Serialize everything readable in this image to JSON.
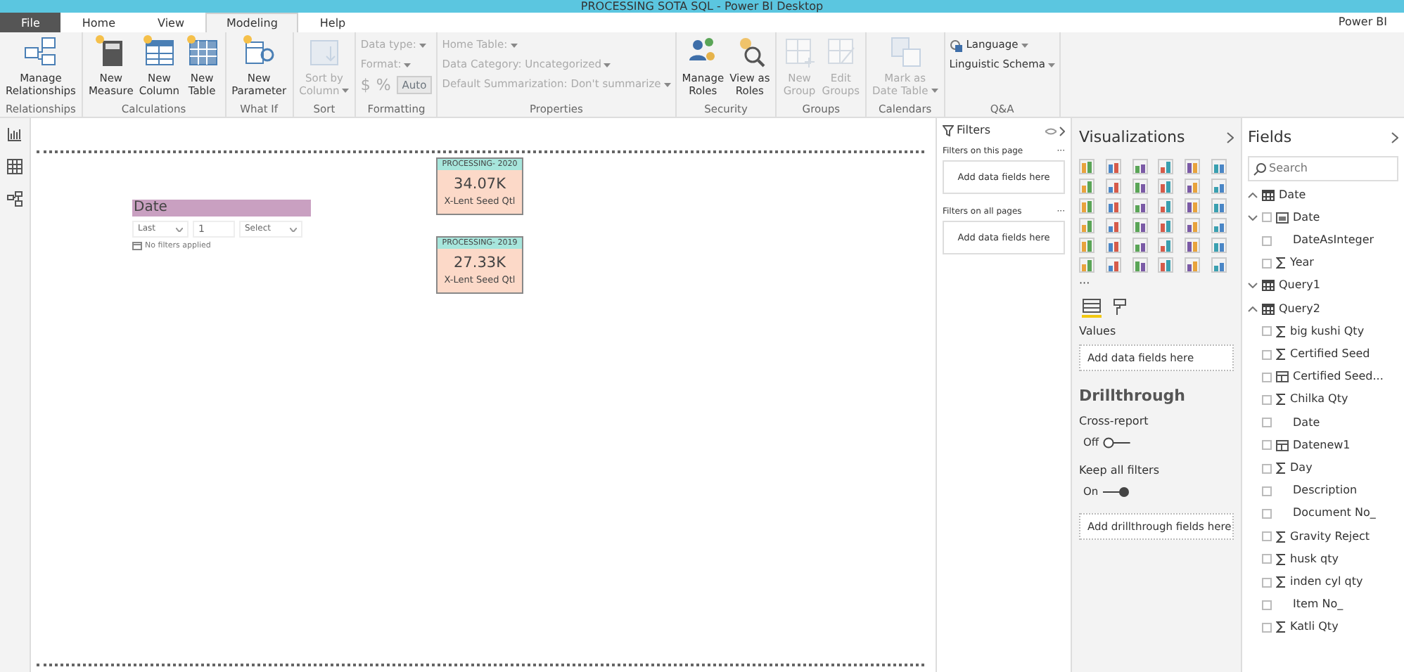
{
  "window": {
    "title": "PROCESSING SOTA SQL - Power BI Desktop"
  },
  "tabs": [
    {
      "label": "File",
      "selected": false,
      "kind": "file"
    },
    {
      "label": "Home",
      "selected": false,
      "kind": "tab"
    },
    {
      "label": "View",
      "selected": false,
      "kind": "tab"
    },
    {
      "label": "Modeling",
      "selected": true,
      "kind": "tab"
    },
    {
      "label": "Help",
      "selected": false,
      "kind": "tab"
    }
  ],
  "account": {
    "label": "Power BI"
  },
  "ribbon_groups": [
    {
      "name": "Relationships",
      "items": [
        {
          "kind": "big",
          "lines": [
            "Manage",
            "Relationships"
          ]
        }
      ]
    },
    {
      "name": "Calculations",
      "items": [
        {
          "kind": "big",
          "lines": [
            "New",
            "Measure"
          ]
        },
        {
          "kind": "big",
          "lines": [
            "New",
            "Column"
          ]
        },
        {
          "kind": "big",
          "lines": [
            "New",
            "Table"
          ]
        }
      ]
    },
    {
      "name": "What If",
      "items": [
        {
          "kind": "big",
          "lines": [
            "New",
            "Parameter"
          ]
        }
      ]
    },
    {
      "name": "Sort",
      "items": [
        {
          "kind": "big",
          "lines": [
            "Sort by",
            "Column"
          ],
          "disabled": true,
          "dropdown": true
        }
      ]
    },
    {
      "name": "Formatting",
      "items": [
        {
          "kind": "small",
          "text": "Data type:",
          "disabled": true,
          "dropdown": true
        },
        {
          "kind": "small",
          "text": "Format:",
          "disabled": true,
          "dropdown": true
        },
        {
          "kind": "format",
          "currency": "$",
          "percent": "%",
          "auto": "Auto",
          "disabled": true
        }
      ]
    },
    {
      "name": "Properties",
      "items": [
        {
          "kind": "small",
          "text": "Home Table:",
          "disabled": true,
          "dropdown": true
        },
        {
          "kind": "small",
          "text": "Data Category: Uncategorized",
          "disabled": true,
          "dropdown": true
        },
        {
          "kind": "small",
          "text": "Default Summarization: Don't summarize",
          "disabled": true,
          "dropdown": true
        }
      ]
    },
    {
      "name": "Security",
      "items": [
        {
          "kind": "big",
          "lines": [
            "Manage",
            "Roles"
          ]
        },
        {
          "kind": "big",
          "lines": [
            "View as",
            "Roles"
          ]
        }
      ]
    },
    {
      "name": "Groups",
      "items": [
        {
          "kind": "big",
          "lines": [
            "New",
            "Group"
          ],
          "disabled": true
        },
        {
          "kind": "big",
          "lines": [
            "Edit",
            "Groups"
          ],
          "disabled": true
        }
      ]
    },
    {
      "name": "Calendars",
      "items": [
        {
          "kind": "big",
          "lines": [
            "Mark as",
            "Date Table"
          ],
          "disabled": true,
          "dropdown": true
        }
      ]
    },
    {
      "name": "Q&A",
      "items": [
        {
          "kind": "small",
          "text": "Language",
          "dropdown": true,
          "icon": true
        },
        {
          "kind": "small",
          "text": "Linguistic Schema",
          "dropdown": true
        }
      ]
    }
  ],
  "canvas": {
    "slicer": {
      "title": "Date",
      "mode": "Last",
      "count": "1",
      "unit": "Select",
      "note": "No filters applied"
    },
    "cards": [
      {
        "header": "PROCESSING- 2020",
        "value": "34.07K",
        "label": "X-Lent Seed Qtl"
      },
      {
        "header": "PROCESSING- 2019",
        "value": "27.33K",
        "label": "X-Lent Seed Qtl"
      }
    ]
  },
  "filters": {
    "title": "Filters",
    "sections": [
      {
        "label": "Filters on this page",
        "more": "···",
        "drop": "Add data fields here"
      },
      {
        "label": "Filters on all pages",
        "more": "···",
        "drop": "Add data fields here"
      }
    ]
  },
  "visualizations": {
    "title": "Visualizations",
    "more": "···",
    "wells": [
      {
        "label": "Values",
        "drop": "Add data fields here"
      }
    ],
    "drillthrough": {
      "title": "Drillthrough",
      "toggles": [
        {
          "label": "Cross-report",
          "state": "Off",
          "on": false
        },
        {
          "label": "Keep all filters",
          "state": "On",
          "on": true
        }
      ],
      "drop": "Add drillthrough fields here"
    }
  },
  "fields": {
    "title": "Fields",
    "search": {
      "placeholder": "Search"
    },
    "tables": [
      {
        "name": "Date",
        "expanded": true,
        "children": [
          {
            "name": "Date",
            "kind": "calendar",
            "expandable": true,
            "checked": false
          },
          {
            "name": "DateAsInteger",
            "kind": "plain",
            "checked": false
          },
          {
            "name": "Year",
            "kind": "sum",
            "checked": false
          }
        ]
      },
      {
        "name": "Query1",
        "expanded": false
      },
      {
        "name": "Query2",
        "expanded": true,
        "children": [
          {
            "name": "big kushi Qty",
            "kind": "sum",
            "checked": false
          },
          {
            "name": "Certified Seed",
            "kind": "sum",
            "checked": false
          },
          {
            "name": "Certified Seed...",
            "kind": "measure",
            "checked": false
          },
          {
            "name": "Chilka Qty",
            "kind": "sum",
            "checked": false
          },
          {
            "name": "Date",
            "kind": "plain",
            "checked": false
          },
          {
            "name": "Datenew1",
            "kind": "measure",
            "checked": false
          },
          {
            "name": "Day",
            "kind": "sum",
            "checked": false
          },
          {
            "name": "Description",
            "kind": "plain",
            "checked": false
          },
          {
            "name": "Document No_",
            "kind": "plain",
            "checked": false
          },
          {
            "name": "Gravity Reject",
            "kind": "sum",
            "checked": false
          },
          {
            "name": "husk qty",
            "kind": "sum",
            "checked": false
          },
          {
            "name": "inden cyl qty",
            "kind": "sum",
            "checked": false
          },
          {
            "name": "Item No_",
            "kind": "plain",
            "checked": false
          },
          {
            "name": "Katli Qty",
            "kind": "sum",
            "checked": false
          }
        ]
      }
    ]
  }
}
